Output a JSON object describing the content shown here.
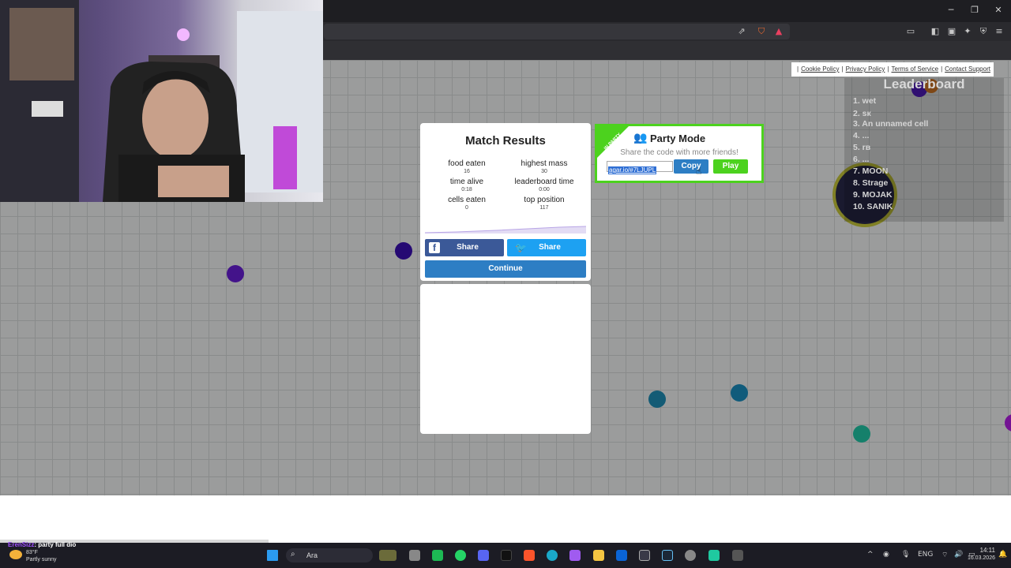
{
  "footer_links": [
    "Cookie Policy",
    "Privacy Policy",
    "Terms of Service",
    "Contact Support"
  ],
  "leaderboard": {
    "title": "Leaderboard",
    "rows": [
      "1. wet",
      "2. sк",
      "3. An unnamed cell",
      "4. ...",
      "5. rв",
      "6. ...",
      "7. MOON",
      "8. Strage",
      "9. MOJAK",
      "10. SANIK"
    ]
  },
  "match_results": {
    "title": "Match Results",
    "stats": [
      {
        "label": "food eaten",
        "value": "16"
      },
      {
        "label": "highest mass",
        "value": "30"
      },
      {
        "label": "time alive",
        "value": "0:18"
      },
      {
        "label": "leaderboard time",
        "value": "0:00"
      },
      {
        "label": "cells eaten",
        "value": "0"
      },
      {
        "label": "top position",
        "value": "117"
      }
    ],
    "share_facebook": "Share",
    "share_twitter": "Share",
    "continue_label": "Continue"
  },
  "party": {
    "ribbon": "IN PARTY",
    "title": "Party Mode",
    "subtitle": "Share the code with more friends!",
    "code": "agar.io/#7LJUPL",
    "copy_label": "Copy",
    "play_label": "Play"
  },
  "taskbar": {
    "chat_user": "ErenSizz",
    "chat_text": ": party full dio",
    "weather_temp": "83°F",
    "weather_text": "Partly sunny",
    "search_label": "Ara",
    "language": "ENG",
    "time": "14:11",
    "date": "16.03.2026"
  },
  "colors": {
    "party_green": "#4cd21e",
    "facebook_blue": "#3b5998",
    "twitter_blue": "#1da1f2",
    "continue_blue": "#2d7ec4"
  }
}
